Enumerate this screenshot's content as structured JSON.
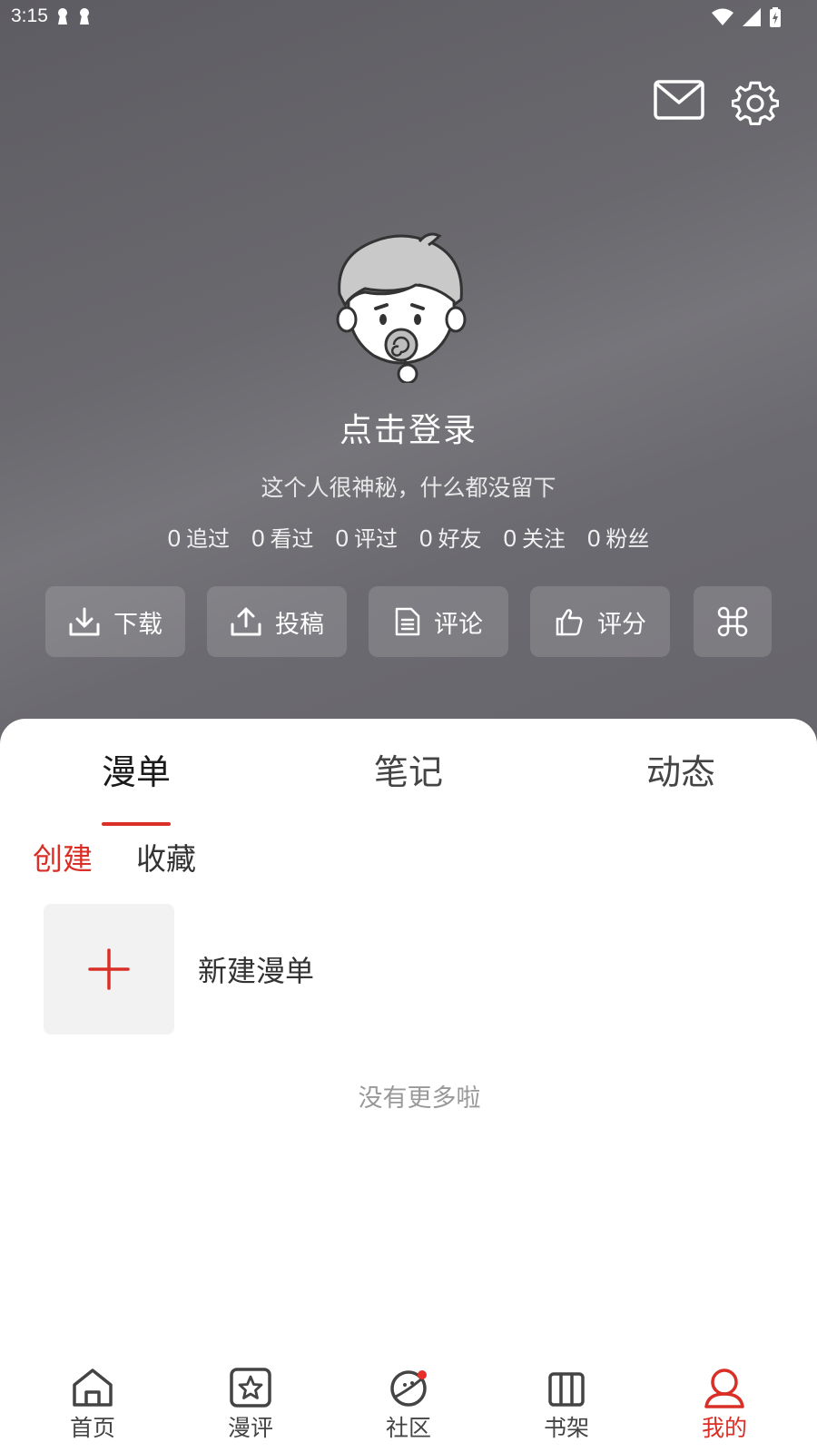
{
  "status_bar": {
    "time": "3:15"
  },
  "profile": {
    "login_prompt": "点击登录",
    "bio": "这个人很神秘，什么都没留下",
    "stats": [
      {
        "value": "0",
        "label": "追过"
      },
      {
        "value": "0",
        "label": "看过"
      },
      {
        "value": "0",
        "label": "评过"
      },
      {
        "value": "0",
        "label": "好友"
      },
      {
        "value": "0",
        "label": "关注"
      },
      {
        "value": "0",
        "label": "粉丝"
      }
    ]
  },
  "actions": [
    {
      "label": "下载",
      "icon": "download-icon"
    },
    {
      "label": "投稿",
      "icon": "upload-icon"
    },
    {
      "label": "评论",
      "icon": "document-icon"
    },
    {
      "label": "评分",
      "icon": "thumbs-up-icon"
    },
    {
      "label": "",
      "icon": "command-icon"
    }
  ],
  "tabs": [
    {
      "label": "漫单",
      "active": true
    },
    {
      "label": "笔记",
      "active": false
    },
    {
      "label": "动态",
      "active": false
    }
  ],
  "subtabs": [
    {
      "label": "创建",
      "active": true
    },
    {
      "label": "收藏",
      "active": false
    }
  ],
  "list": {
    "new_label": "新建漫单",
    "end_text": "没有更多啦"
  },
  "bottom_nav": [
    {
      "label": "首页",
      "icon": "home-icon",
      "active": false
    },
    {
      "label": "漫评",
      "icon": "star-icon",
      "active": false
    },
    {
      "label": "社区",
      "icon": "planet-icon",
      "active": false,
      "badge": true
    },
    {
      "label": "书架",
      "icon": "bookshelf-icon",
      "active": false
    },
    {
      "label": "我的",
      "icon": "user-icon",
      "active": true
    }
  ],
  "colors": {
    "accent": "#d92f26",
    "header_bg": "#66656b"
  }
}
